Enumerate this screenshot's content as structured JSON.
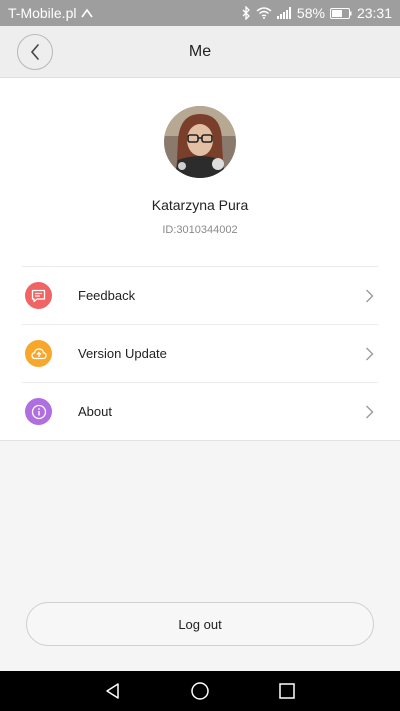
{
  "status_bar": {
    "carrier": "T-Mobile.pl",
    "battery": "58%",
    "time": "23:31",
    "icons": [
      "bluetooth-icon",
      "wifi-icon",
      "signal-icon",
      "battery-icon"
    ]
  },
  "header": {
    "title": "Me",
    "back_icon": "chevron-left-icon"
  },
  "profile": {
    "name": "Katarzyna Pura",
    "id": "ID:3010344002"
  },
  "menu": {
    "items": [
      {
        "label": "Feedback",
        "icon": "chat-bubble-icon",
        "color": "#f06464"
      },
      {
        "label": "Version Update",
        "icon": "cloud-upload-icon",
        "color": "#f9a72b"
      },
      {
        "label": "About",
        "icon": "info-icon",
        "color": "#b06fe0"
      }
    ]
  },
  "logout": {
    "label": "Log out"
  },
  "nav_bar": {
    "icons": [
      "back-triangle-icon",
      "home-circle-icon",
      "recents-square-icon"
    ]
  }
}
